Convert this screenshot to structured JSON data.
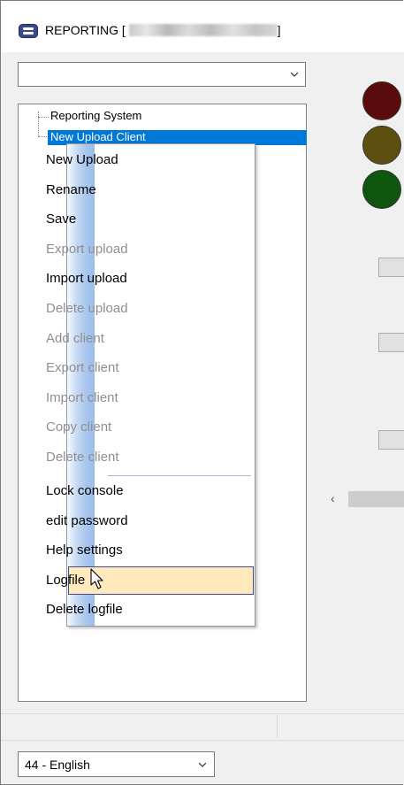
{
  "window": {
    "title": "REPORTING [",
    "title_suffix": "]",
    "icon": "app-logo-icon"
  },
  "top_combo": {
    "value": ""
  },
  "tree": {
    "items": [
      {
        "label": "Reporting System"
      },
      {
        "label": "New Upload Client"
      }
    ]
  },
  "context_menu": {
    "items": [
      {
        "label": "New Upload",
        "enabled": true
      },
      {
        "label": "Rename",
        "enabled": true
      },
      {
        "label": "Save",
        "enabled": true
      },
      {
        "label": "Export upload",
        "enabled": false
      },
      {
        "label": "Import upload",
        "enabled": true
      },
      {
        "label": "Delete upload",
        "enabled": false
      },
      {
        "label": "Add client",
        "enabled": false
      },
      {
        "label": "Export client",
        "enabled": false
      },
      {
        "label": "Import client",
        "enabled": false
      },
      {
        "label": "Copy client",
        "enabled": false
      },
      {
        "label": "Delete client",
        "enabled": false
      },
      {
        "label": "Lock console",
        "enabled": true
      },
      {
        "label": "edit password",
        "enabled": true
      },
      {
        "label": "Help settings",
        "enabled": true
      },
      {
        "label": "Logfile",
        "enabled": true,
        "highlighted": true
      },
      {
        "label": "Delete logfile",
        "enabled": true
      }
    ]
  },
  "status_lights": [
    {
      "color": "#5a0c0c",
      "name": "red"
    },
    {
      "color": "#5d4f10",
      "name": "yellow"
    },
    {
      "color": "#0e560e",
      "name": "green"
    }
  ],
  "language_combo": {
    "value": "44 - English"
  },
  "colors": {
    "selection": "#0078d7",
    "menu_highlight": "#ffe9bd",
    "menu_highlight_border": "#3c4b93"
  }
}
